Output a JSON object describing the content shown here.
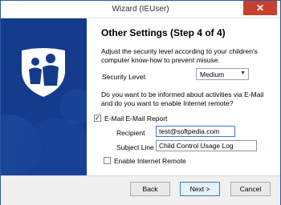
{
  "window": {
    "title": "Wizard (IEUser)",
    "close_glyph": "✕"
  },
  "page": {
    "heading": "Other Settings (Step 4 of 4)",
    "description": "Adjust the security level according to your children's computer know-how to prevent misuse.",
    "security_label": "Security Level:",
    "security_value": "Medium",
    "question": "Do you want to be informed about activities via E-Mail and do you want to enable Internet remote?"
  },
  "email": {
    "checkbox_label": "E-Mail E-Mail Report",
    "checked": true,
    "recipient_label": "Recipient",
    "recipient_value": "test@softpedia.com",
    "subject_label": "Subject Line",
    "subject_value": "Child Control Usage Log"
  },
  "remote": {
    "checkbox_label": "Enable Internet Remote",
    "checked": false
  },
  "buttons": {
    "back": "Back",
    "next": "Next >",
    "cancel": "Cancel"
  },
  "icons": {
    "logo": "family-shield-icon",
    "close": "close-icon",
    "dropdown": "chevron-down-icon",
    "check": "checkmark-icon"
  },
  "colors": {
    "sidebar": "#143b8c",
    "close_button": "#c7402e",
    "accent": "#3b78d8"
  }
}
